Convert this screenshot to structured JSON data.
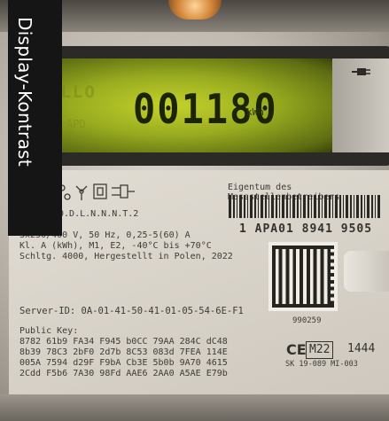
{
  "overlay_label": "Display-Kontrast",
  "lcd": {
    "reading": "001180",
    "dim_prefix": "ALLO",
    "unit": "kWh",
    "sub": "APD"
  },
  "nameplate": {
    "owner": "Eigentum des Messstellenbetreibers",
    "serial": "1 APA01 8941 9505",
    "meter_type": "60.D.L.N.N.N.T.2",
    "specs": "3x230/400 V, 50 Hz, 0,25-5(60) A\nKl. A (kWh), M1, E2, -40°C bis +70°C\nSchltg. 4000, Hergestellt in Polen, 2022",
    "server_id": "Server-ID:  0A-01-41-50-41-01-05-54-6E-F1",
    "qr_number": "990259",
    "public_key_label": "Public Key:",
    "public_key": "8782 61b9 FA34 F945 b0CC 79AA 284C dC48\n8b39 78C3 2bF0 2d7b 8C53 083d 7FEA 114E\n005A 7594 d29F F9bA Cb3E 5b0b 9A70 4615\n2Cdd F5b6 7A30 98Fd AAE6 2AA0 A5AE E79b",
    "ce_mark": "CE",
    "m_mark": "M22",
    "m_number": "1444",
    "certificate": "SK 19-089 MI-003"
  },
  "colors": {
    "lcd_backlight": "#a8bc22",
    "label_bg": "#151515",
    "label_text": "#ffffff"
  }
}
